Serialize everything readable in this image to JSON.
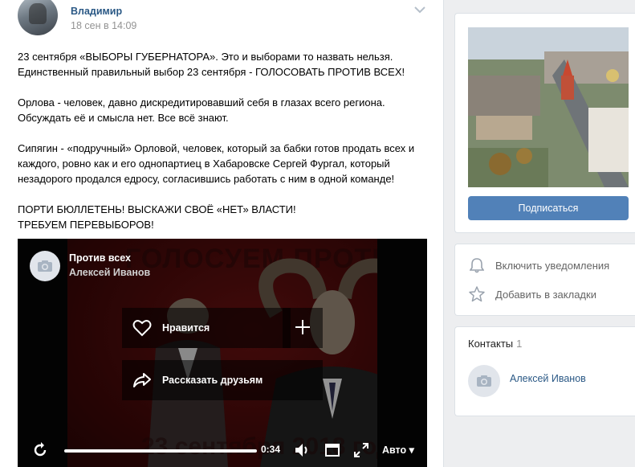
{
  "post": {
    "author": "Владимир",
    "date": "18 сен в 14:09",
    "paragraphs": [
      [
        "23 сентября «ВЫБОРЫ ГУБЕРНАТОРА». Это и выборами то назвать нельзя.",
        "Единственный правильный выбор 23 сентября - ГОЛОСОВАТЬ ПРОТИВ ВСЕХ!"
      ],
      [
        "Орлова - человек, давно дискредитировавший себя в глазах всего региона.",
        "Обсуждать её и смысла нет. Все всё знают."
      ],
      [
        "Сипягин - «подручный» Орловой, человек, который за бабки готов продать всех и",
        "каждого, ровно как и его однопартиец в Хабаровске Сергей Фургал, который",
        "незадорого продался едросу, согласившись работать с ним в одной команде!"
      ],
      [
        "ПОРТИ БЮЛЛЕТЕНЬ! ВЫСКАЖИ СВОЁ «НЕТ» ВЛАСТИ!",
        "ТРЕБУЕМ ПЕРЕВЫБОРОВ!"
      ]
    ]
  },
  "video": {
    "title": "Против всех",
    "channel": "Алексей Иванов",
    "background_top_text": "ГОЛОСУЕМ ПРОТИВ ВСЕХ!!!",
    "background_bottom_text": "23 сентября 2018 года",
    "like_label": "Нравится",
    "share_label": "Рассказать друзьям",
    "time": "0:34",
    "quality": "Авто",
    "progress": 0.0
  },
  "sidebar": {
    "subscribe_label": "Подписаться",
    "notify_label": "Включить уведомления",
    "bookmark_label": "Добавить в закладки",
    "contacts_title": "Контакты",
    "contacts_count": "1",
    "contact_name": "Алексей Иванов"
  },
  "colors": {
    "link": "#2a5885",
    "button": "#5181b8",
    "muted": "#939393",
    "background": "#edeef0"
  },
  "icons": [
    "chevron-down-icon",
    "camera-icon",
    "heart-icon",
    "plus-icon",
    "share-icon",
    "replay-icon",
    "volume-icon",
    "miniplayer-icon",
    "fullscreen-icon",
    "bell-icon",
    "star-icon"
  ]
}
